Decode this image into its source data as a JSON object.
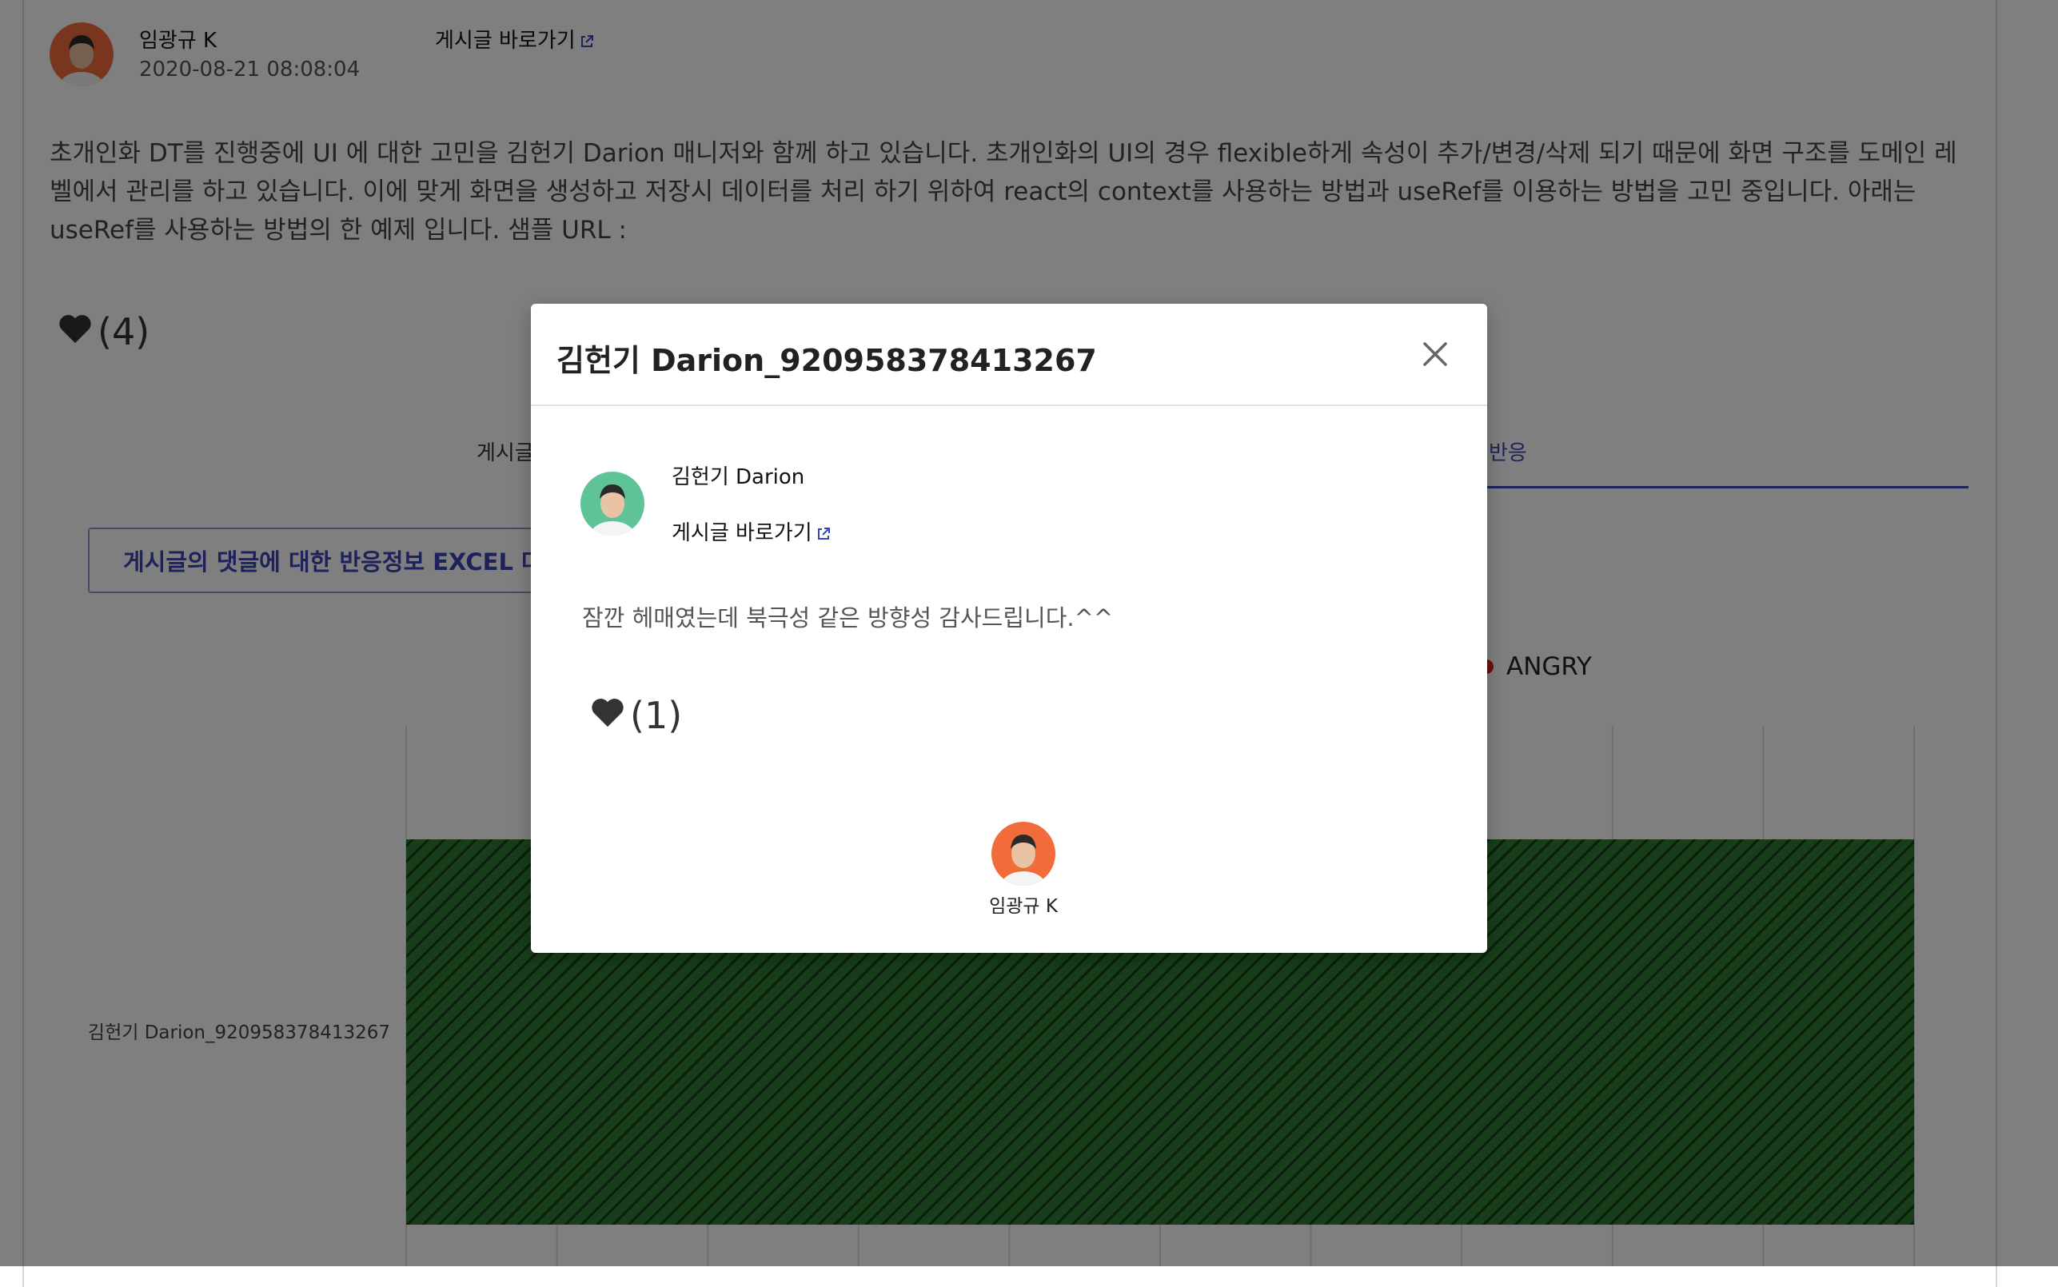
{
  "post": {
    "author_name": "임광규 K",
    "date": "2020-08-21 08:08:04",
    "link_label": "게시글 바로가기",
    "body": "초개인화 DT를 진행중에 UI 에 대한 고민을 김헌기 Darion 매니저와 함께 하고 있습니다. 초개인화의 UI의 경우 flexible하게 속성이 추가/변경/삭제 되기 때문에 화면 구조를 도메인 레벨에서 관리를 하고 있습니다. 이에 맞게 화면을 생성하고 저장시 데이터를 처리 하기 위하여 react의 context를 사용하는 방법과 useRef를 이용하는 방법을 고민 중입니다. 아래는 useRef를 사용하는 방법의 한 예제 입니다. 샘플 URL :",
    "likes": "(4)"
  },
  "tabs": {
    "left_label": "게시글",
    "right_label": "반응"
  },
  "excel_button_label": "게시글의 댓글에 대한 반응정보 EXCEL 다운로드",
  "legend": {
    "angry_label": "ANGRY",
    "angry_color": "#d62027"
  },
  "chart_data": {
    "type": "bar",
    "orientation": "horizontal",
    "categories": [
      "김헌기 Darion_920958378413267"
    ],
    "series": [
      {
        "values": [
          1
        ],
        "color": "#2e7d32",
        "pattern": "diagonal-hatch"
      }
    ],
    "xlim": [
      0,
      1
    ],
    "grid": true
  },
  "modal": {
    "title": "김헌기 Darion_920958378413267",
    "commenter_name": "김헌기 Darion",
    "link_label": "게시글 바로가기",
    "comment": "잠깐 헤매였는데 북극성 같은 방향성 감사드립니다.^^",
    "likes": "(1)",
    "reactor_name": "임광규 K"
  },
  "icons": {
    "heart": "heart-icon",
    "external_link": "external-link-icon",
    "close": "close-icon"
  },
  "colors": {
    "accent": "#3a46b5",
    "overlay": "rgba(0,0,0,0.5)",
    "avatar_orange": "#f26b3a",
    "avatar_green": "#5fc39a"
  }
}
